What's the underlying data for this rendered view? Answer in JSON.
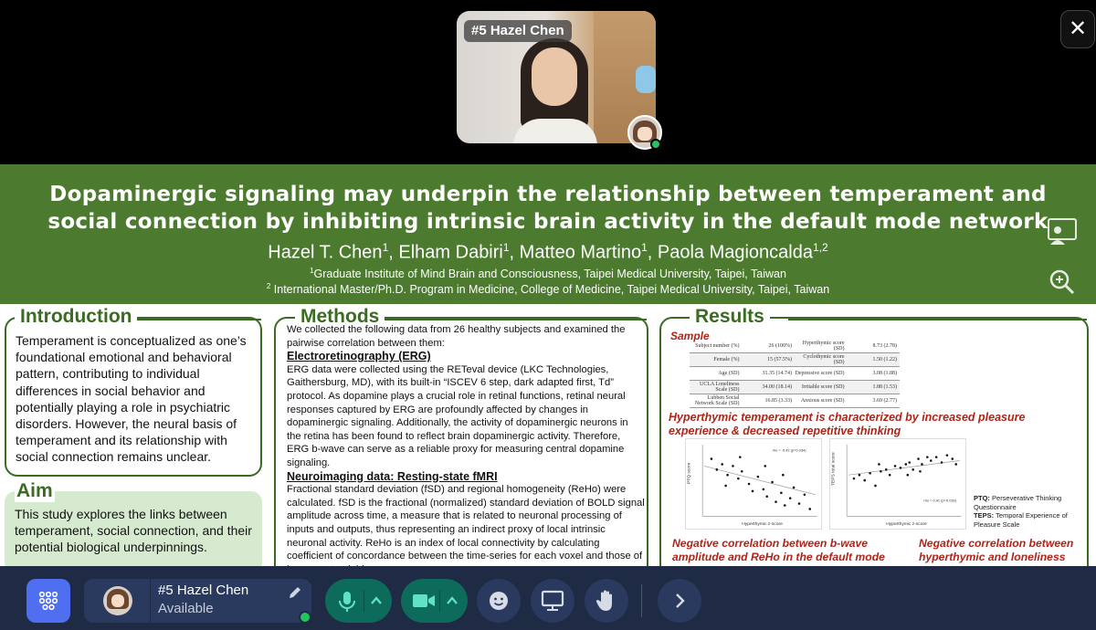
{
  "video": {
    "name_tag": "#5 Hazel Chen"
  },
  "window": {
    "close_glyph": "✕"
  },
  "poster": {
    "title_line1": "Dopaminergic signaling may underpin the relationship between temperament and",
    "title_line2": "social connection by inhibiting intrinsic brain activity in the default mode network",
    "authors": [
      {
        "name": "Hazel T. Chen",
        "aff": "1"
      },
      {
        "name": "Elham Dabiri",
        "aff": "1"
      },
      {
        "name": "Matteo Martino",
        "aff": "1"
      },
      {
        "name": "Paola Magioncalda",
        "aff": "1,2"
      }
    ],
    "affiliations": [
      {
        "num": "1",
        "text": "Graduate Institute of Mind Brain and Consciousness, Taipei Medical University, Taipei, Taiwan"
      },
      {
        "num": "2",
        "text": "International Master/Ph.D. Program in Medicine, College of Medicine, Taipei Medical University, Taipei, Taiwan"
      }
    ],
    "introduction": {
      "heading": "Introduction",
      "text": "Temperament is conceptualized as one’s foundational emotional and behavioral pattern, contributing to individual differences in social behavior and potentially playing a role in psychiatric disorders. However, the neural basis of temperament and its relationship with social connection remains unclear."
    },
    "aim": {
      "heading": "Aim",
      "text": "This study explores the links between temperament, social connection, and their potential biological underpinnings."
    },
    "methods": {
      "heading": "Methods",
      "intro": "We collected the following data from 26 healthy subjects and examined the pairwise correlation between them:",
      "erg_heading": "Electroretinography (ERG)",
      "erg_text": "ERG data were collected using the RETeval device (LKC Technologies, Gaithersburg, MD), with its built-in “ISCEV 6 step, dark adapted first, Td” protocol. As dopamine plays a crucial role in retinal functions, retinal neural responses captured by ERG are profoundly affected by changes in dopaminergic signaling. Additionally, the activity of dopaminergic neurons in the retina has been found to reflect brain dopaminergic activity. Therefore, ERG b-wave can serve as a reliable proxy for measuring central dopamine signaling.",
      "fmri_heading": "Neuroimaging data: Resting-state fMRI",
      "fmri_text": "Fractional standard deviation (fSD) and regional homogeneity (ReHo) were calculated. fSD is the fractional (normalized) standard deviation of BOLD signal amplitude across time, a measure that is related to neuronal processing of inputs and outputs, thus representing an indirect proxy of local intrinsic neuronal activity. ReHo is an index of local connectivity by calculating coefficient of concordance between the time-series for each voxel and those of its nearest neighbors."
    },
    "results": {
      "heading": "Results",
      "sample_label": "Sample",
      "table_rows": [
        [
          "Subject number (%)",
          "26 (100%)",
          "Hyperthymic score (SD)",
          "8.73 (2.78)"
        ],
        [
          "Female (%)",
          "15 (57.5%)",
          "Cyclothymic score (SD)",
          "1.50 (1.22)"
        ],
        [
          "Age (SD)",
          "31.35 (14.74)",
          "Depressive score (SD)",
          "3.08 (1.88)"
        ],
        [
          "UCLA Loneliness Scale (SD)",
          "34.00 (18.14)",
          "Irritable score (SD)",
          "1.88 (1.53)"
        ],
        [
          "Lubben Social Network Scale (SD)",
          "16.85 (3.33)",
          "Anxious score (SD)",
          "3.69 (2.77)"
        ]
      ],
      "hyper_caption": "Hyperthymic temperament is characterized by increased pleasure experience & decreased repetitive thinking",
      "plot1": {
        "ylabel": "PTQ score",
        "xlabel": "Hyperthymic z-score",
        "annotation": "rho = -0.42 (p=0.034)"
      },
      "plot2": {
        "ylabel": "TEPS total score",
        "xlabel": "Hyperthymic z-score",
        "annotation": "rho = 0.41 (p=0.039)"
      },
      "legend_notes": [
        {
          "key": "PTQ:",
          "text": "Perseverative Thinking Questionnaire"
        },
        {
          "key": "TEPS:",
          "text": "Temporal Experience of Pleasure Scale"
        }
      ],
      "neg1_caption": "Negative correlation between b-wave amplitude and ReHo in the default mode network (DMN)",
      "neg2_caption": "Negative correlation between hyperthymic and loneliness scores"
    }
  },
  "toolbar": {
    "user_name": "#5 Hazel Chen",
    "user_status": "Available"
  },
  "icons": [
    "apps-grid-icon",
    "mic-icon",
    "camera-icon",
    "emoji-icon",
    "screen-share-icon",
    "raise-hand-icon",
    "chevron-right-icon",
    "chevron-up-icon",
    "pencil-icon",
    "close-icon",
    "presenter-icon",
    "zoom-in-icon"
  ]
}
